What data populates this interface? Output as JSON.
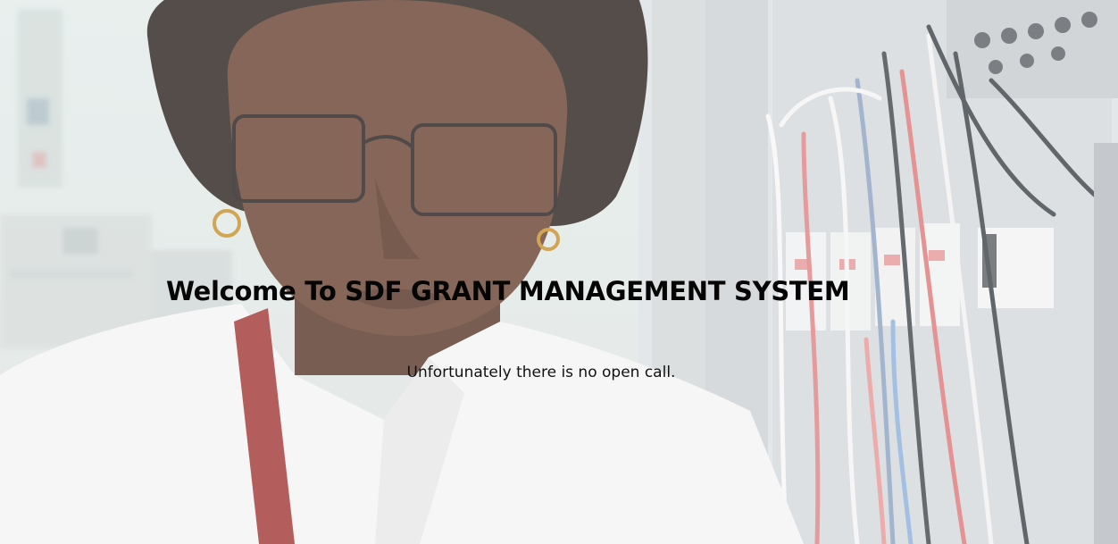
{
  "hero": {
    "title": "Welcome To SDF GRANT MANAGEMENT SYSTEM",
    "message": "Unfortunately there is no open call."
  },
  "colors": {
    "background_tint": "#e9eceb",
    "heading_text": "#050505",
    "body_text": "#111111"
  }
}
